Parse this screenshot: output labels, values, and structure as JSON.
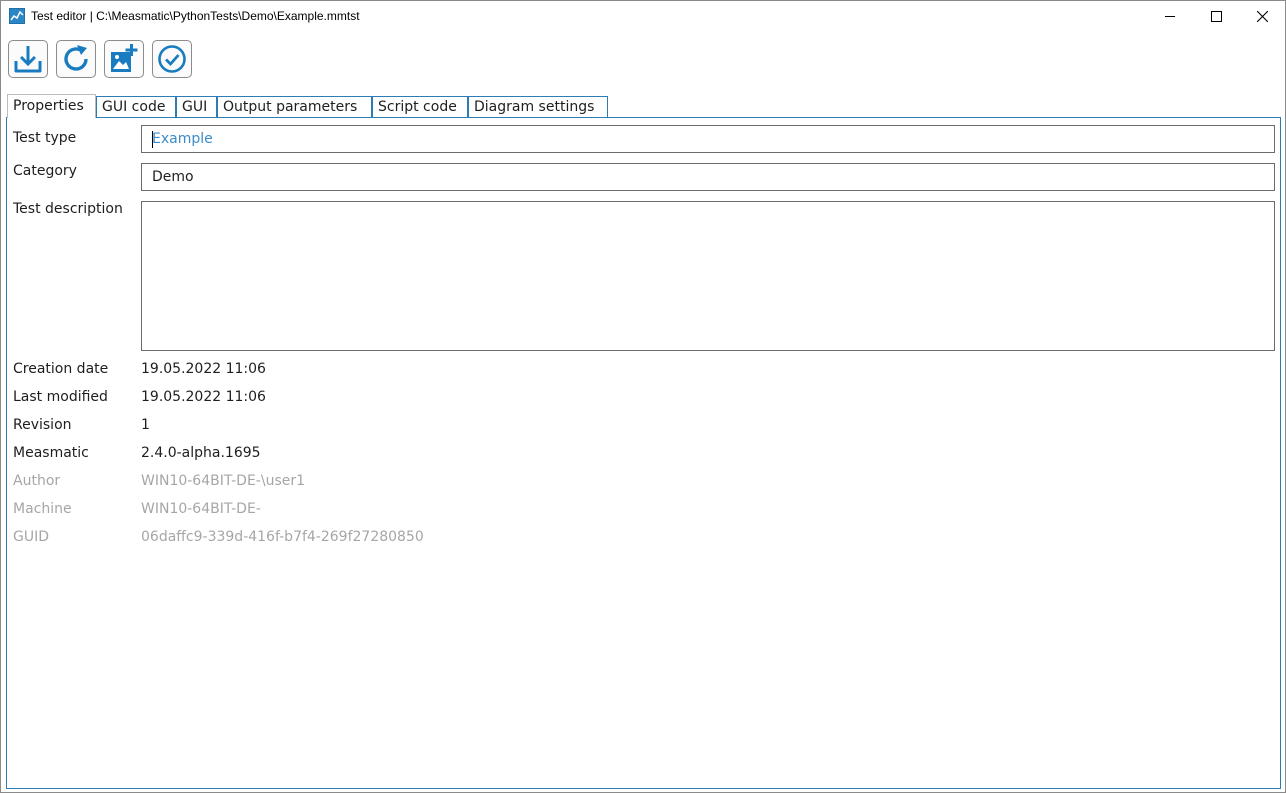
{
  "window": {
    "title": "Test editor | C:\\Measmatic\\PythonTests\\Demo\\Example.mmtst"
  },
  "toolbar": [
    {
      "name": "save-button",
      "icon": "download-icon"
    },
    {
      "name": "reload-button",
      "icon": "refresh-icon"
    },
    {
      "name": "add-image-button",
      "icon": "add-image-icon"
    },
    {
      "name": "validate-button",
      "icon": "check-circle-icon"
    }
  ],
  "tabs": [
    {
      "label": "Properties",
      "active": true
    },
    {
      "label": "GUI code"
    },
    {
      "label": "GUI"
    },
    {
      "label": "Output parameters"
    },
    {
      "label": "Script code"
    },
    {
      "label": "Diagram settings"
    }
  ],
  "form": {
    "test_type": {
      "label": "Test type",
      "value": "Example"
    },
    "category": {
      "label": "Category",
      "value": "Demo"
    },
    "description": {
      "label": "Test description",
      "value": ""
    },
    "creation_date": {
      "label": "Creation date",
      "value": "19.05.2022 11:06"
    },
    "last_modified": {
      "label": "Last modified",
      "value": "19.05.2022 11:06"
    },
    "revision": {
      "label": "Revision",
      "value": "1"
    },
    "measmatic": {
      "label": "Measmatic",
      "value": "2.4.0-alpha.1695"
    },
    "author": {
      "label": "Author",
      "value": "WIN10-64BIT-DE-\\user1"
    },
    "machine": {
      "label": "Machine",
      "value": "WIN10-64BIT-DE-"
    },
    "guid": {
      "label": "GUID",
      "value": "06daffc9-339d-416f-b7f4-269f27280850"
    }
  },
  "colors": {
    "accent": "#2b7db3",
    "icon": "#1a7cc0",
    "muted_text": "#a6a6a6"
  }
}
